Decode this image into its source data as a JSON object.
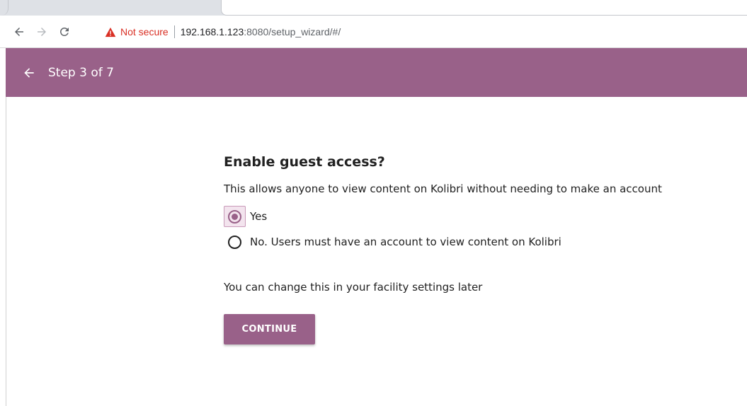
{
  "browser": {
    "security_label": "Not secure",
    "url_host": "192.168.1.123",
    "url_rest": ":8080/setup_wizard/#/"
  },
  "appbar": {
    "title": "Step 3 of 7"
  },
  "content": {
    "heading": "Enable guest access?",
    "description": "This allows anyone to view content on Kolibri without needing to make an account",
    "options": [
      {
        "label": "Yes",
        "selected": true
      },
      {
        "label": "No. Users must have an account to view content on Kolibri",
        "selected": false
      }
    ],
    "hint": "You can change this in your facility settings later",
    "continue_label": "CONTINUE"
  },
  "colors": {
    "brand": "#996189",
    "warning": "#d93025"
  }
}
